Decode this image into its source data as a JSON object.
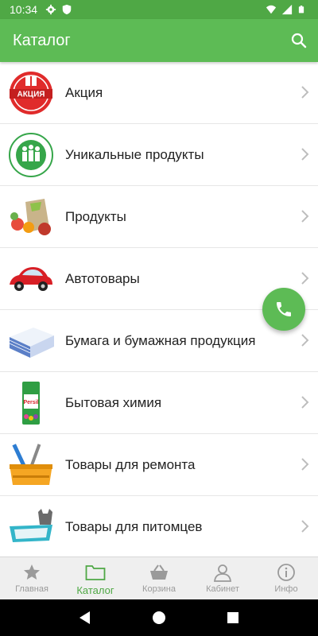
{
  "status_bar": {
    "time": "10:34"
  },
  "app_bar": {
    "title": "Каталог",
    "search_icon": "search-icon"
  },
  "categories": [
    {
      "label": "Акция",
      "badge_text": "АКЦИЯ",
      "icon": "promo-badge-icon"
    },
    {
      "label": "Уникальные продукты",
      "icon": "family-logo-icon"
    },
    {
      "label": "Продукты",
      "icon": "groceries-icon"
    },
    {
      "label": "Автотовары",
      "icon": "car-icon"
    },
    {
      "label": "Бумага и бумажная продукция",
      "icon": "paper-stack-icon"
    },
    {
      "label": "Бытовая химия",
      "icon": "detergent-icon",
      "brand_text": "Persil"
    },
    {
      "label": "Товары для ремонта",
      "icon": "toolbox-icon"
    },
    {
      "label": "Товары для питомцев",
      "icon": "pet-tray-icon"
    }
  ],
  "fab": {
    "icon": "phone-icon"
  },
  "bottom_nav": [
    {
      "label": "Главная",
      "icon": "star-icon",
      "active": false
    },
    {
      "label": "Каталог",
      "icon": "folder-icon",
      "active": true
    },
    {
      "label": "Корзина",
      "icon": "basket-icon",
      "active": false
    },
    {
      "label": "Кабинет",
      "icon": "user-icon",
      "active": false
    },
    {
      "label": "Инфо",
      "icon": "info-icon",
      "active": false
    }
  ],
  "colors": {
    "primary": "#5dbb55",
    "status_bar": "#4fa845",
    "active_nav": "#4fa845",
    "inactive_nav": "#9a9a9a"
  }
}
